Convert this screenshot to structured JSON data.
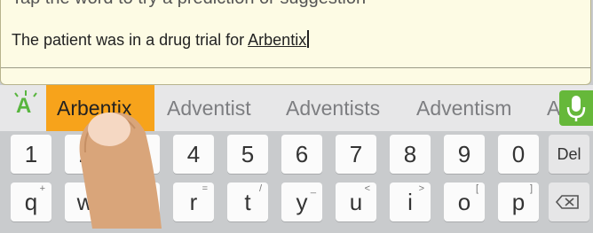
{
  "text_field": {
    "hint": "Tap the word to try a prediction or suggestion",
    "before_word": "The patient was in a drug trial for ",
    "current_word": "Arbentix"
  },
  "suggestions": {
    "items": [
      "Arbentix",
      "Adventist",
      "Adventists",
      "Adventism",
      "A"
    ],
    "selected_index": 0
  },
  "icons": {
    "app_logo": "swype-a-logo",
    "mic": "microphone-icon",
    "backspace": "backspace-icon",
    "finger": "finger-pointer"
  },
  "keyboard": {
    "number_row": [
      "1",
      "2",
      "3",
      "4",
      "5",
      "6",
      "7",
      "8",
      "9",
      "0"
    ],
    "del_label": "Del",
    "letter_row": [
      {
        "key": "q",
        "sub": "+"
      },
      {
        "key": "w",
        "sub": ""
      },
      {
        "key": "e",
        "sub": "÷"
      },
      {
        "key": "r",
        "sub": "="
      },
      {
        "key": "t",
        "sub": "/"
      },
      {
        "key": "y",
        "sub": "_"
      },
      {
        "key": "u",
        "sub": "<"
      },
      {
        "key": "i",
        "sub": ">"
      },
      {
        "key": "o",
        "sub": "["
      },
      {
        "key": "p",
        "sub": "]"
      }
    ]
  },
  "colors": {
    "accent_orange": "#f7a31b",
    "mic_green": "#66b83a",
    "text_area_bg": "#fdfbe4"
  }
}
